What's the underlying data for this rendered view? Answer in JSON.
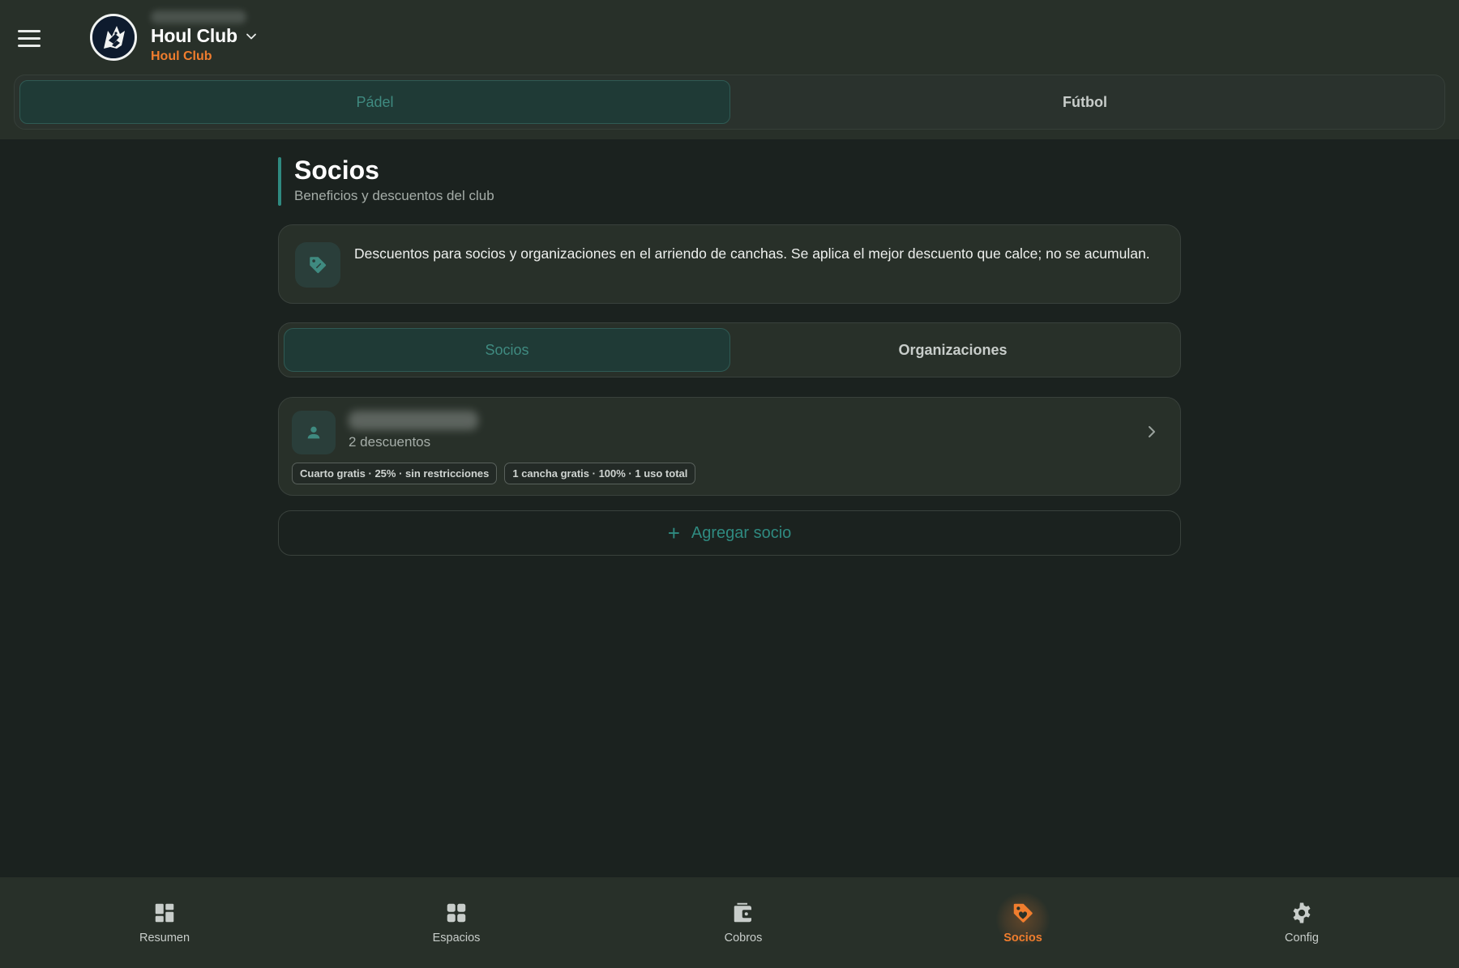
{
  "header": {
    "club_name": "Houl Club",
    "club_subtitle": "Houl Club",
    "accent_color": "#f07d2e"
  },
  "sport_tabs": [
    {
      "label": "Pádel",
      "active": true
    },
    {
      "label": "Fútbol",
      "active": false
    }
  ],
  "page": {
    "title": "Socios",
    "subtitle": "Beneficios y descuentos del club"
  },
  "info": {
    "icon": "tag-icon",
    "text": "Descuentos para socios y organizaciones en el arriendo de canchas. Se aplica el mejor descuento que calce; no se acumulan."
  },
  "segment_tabs": [
    {
      "label": "Socios",
      "active": true
    },
    {
      "label": "Organizaciones",
      "active": false
    }
  ],
  "members": [
    {
      "count_label": "2 descuentos",
      "chips": [
        "Cuarto gratis · 25% · sin restricciones",
        "1 cancha gratis · 100% · 1 uso total"
      ]
    }
  ],
  "add_button": {
    "label": "Agregar socio",
    "color": "#2f8a80"
  },
  "bottom_nav": [
    {
      "label": "Resumen",
      "icon": "dashboard-icon",
      "active": false
    },
    {
      "label": "Espacios",
      "icon": "grid-icon",
      "active": false
    },
    {
      "label": "Cobros",
      "icon": "wallet-icon",
      "active": false
    },
    {
      "label": "Socios",
      "icon": "tag-icon",
      "active": true
    },
    {
      "label": "Config",
      "icon": "gear-icon",
      "active": false
    }
  ]
}
